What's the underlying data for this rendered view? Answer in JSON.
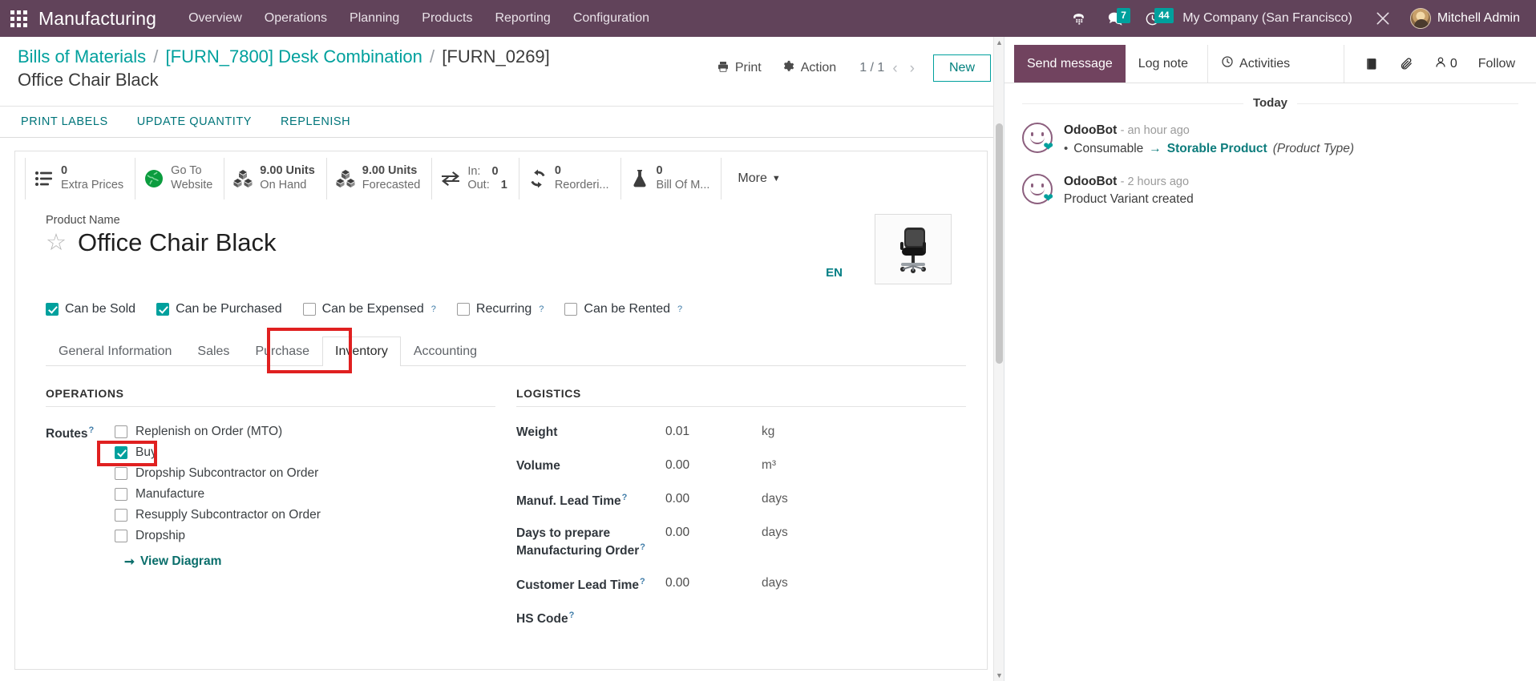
{
  "navbar": {
    "apps_icon": "apps-grid-icon",
    "brand": "Manufacturing",
    "menu": [
      "Overview",
      "Operations",
      "Planning",
      "Products",
      "Reporting",
      "Configuration"
    ],
    "phone_icon": "voip-phone-icon",
    "messages_icon": "messages-icon",
    "messages_count": "7",
    "activities_icon": "clock-activities-icon",
    "activities_count": "44",
    "company": "My Company (San Francisco)",
    "tools_icon": "tools-icon",
    "user": "Mitchell Admin"
  },
  "control_panel": {
    "breadcrumb": {
      "root": "Bills of Materials",
      "parent": "[FURN_7800] Desk Combination",
      "current": "[FURN_0269] Office Chair Black",
      "separator": "/"
    },
    "print_label": "Print",
    "print_icon": "printer-icon",
    "action_label": "Action",
    "action_icon": "gear-icon",
    "pager": "1 / 1",
    "prev_icon": "chevron-left-icon",
    "next_icon": "chevron-right-icon",
    "new_label": "New"
  },
  "statusbar": {
    "buttons": [
      "PRINT LABELS",
      "UPDATE QUANTITY",
      "REPLENISH"
    ]
  },
  "smart_buttons": [
    {
      "icon": "list-lines-icon",
      "value": "0",
      "label": "Extra Prices"
    },
    {
      "icon": "globe-icon",
      "value": "Go To",
      "label": "Website"
    },
    {
      "icon": "cubes-icon",
      "value": "9.00 Units",
      "label": "On Hand"
    },
    {
      "icon": "cubes-icon",
      "value": "9.00 Units",
      "label": "Forecasted"
    },
    {
      "icon": "exchange-arrows-icon",
      "in_label": "In:",
      "in_value": "0",
      "out_label": "Out:",
      "out_value": "1"
    },
    {
      "icon": "refresh-cycle-icon",
      "value": "0",
      "label": "Reorderi..."
    },
    {
      "icon": "flask-icon",
      "value": "0",
      "label": "Bill Of M..."
    }
  ],
  "more_button": {
    "label": "More",
    "icon": "caret-down-icon"
  },
  "product": {
    "name_label": "Product Name",
    "name": "Office Chair Black",
    "favorite_icon": "star-outline-icon",
    "language_badge": "EN",
    "image_icon": "office-chair-photo"
  },
  "flags": [
    {
      "label": "Can be Sold",
      "checked": true,
      "help": false
    },
    {
      "label": "Can be Purchased",
      "checked": true,
      "help": false
    },
    {
      "label": "Can be Expensed",
      "checked": false,
      "help": true
    },
    {
      "label": "Recurring",
      "checked": false,
      "help": true
    },
    {
      "label": "Can be Rented",
      "checked": false,
      "help": true
    }
  ],
  "tabs": [
    {
      "label": "General Information",
      "active": false
    },
    {
      "label": "Sales",
      "active": false
    },
    {
      "label": "Purchase",
      "active": false
    },
    {
      "label": "Inventory",
      "active": true
    },
    {
      "label": "Accounting",
      "active": false
    }
  ],
  "operations": {
    "title": "OPERATIONS",
    "routes_label": "Routes",
    "routes_help": "?",
    "routes": [
      {
        "label": "Replenish on Order (MTO)",
        "checked": false
      },
      {
        "label": "Buy",
        "checked": true
      },
      {
        "label": "Dropship Subcontractor on Order",
        "checked": false
      },
      {
        "label": "Manufacture",
        "checked": false
      },
      {
        "label": "Resupply Subcontractor on Order",
        "checked": false
      },
      {
        "label": "Dropship",
        "checked": false
      }
    ],
    "view_diagram": "View Diagram",
    "view_diagram_icon": "arrow-right-icon"
  },
  "logistics": {
    "title": "LOGISTICS",
    "rows": [
      {
        "label": "Weight",
        "help": false,
        "value": "0.01",
        "unit": "kg"
      },
      {
        "label": "Volume",
        "help": false,
        "value": "0.00",
        "unit": "m³"
      },
      {
        "label": "Manuf. Lead Time",
        "help": true,
        "value": "0.00",
        "unit": "days"
      },
      {
        "label": "Days to prepare Manufacturing Order",
        "help": true,
        "value": "0.00",
        "unit": "days"
      },
      {
        "label": "Customer Lead Time",
        "help": true,
        "value": "0.00",
        "unit": "days"
      },
      {
        "label": "HS Code",
        "help": true,
        "value": "",
        "unit": ""
      }
    ]
  },
  "chatter": {
    "send_message": "Send message",
    "log_note": "Log note",
    "activities": "Activities",
    "activities_icon": "clock-icon",
    "attachments_icon": "paperclip-icon",
    "log_icon": "book-icon",
    "followers_icon": "user-icon",
    "followers_count": "0",
    "follow_label": "Follow",
    "day_separator": "Today",
    "messages": [
      {
        "author": "OdooBot",
        "time": "- an hour ago",
        "bullet": "•",
        "old_value": "Consumable",
        "arrow": "→",
        "new_value": "Storable Product",
        "field": "(Product Type)",
        "plain": ""
      },
      {
        "author": "OdooBot",
        "time": "- 2 hours ago",
        "bullet": "",
        "old_value": "",
        "arrow": "",
        "new_value": "",
        "field": "",
        "plain": "Product Variant created"
      }
    ]
  },
  "colors": {
    "brand_purple": "#61435a",
    "teal": "#00a09d",
    "highlight_red": "#e02020",
    "chatter_primary": "#71435f"
  }
}
